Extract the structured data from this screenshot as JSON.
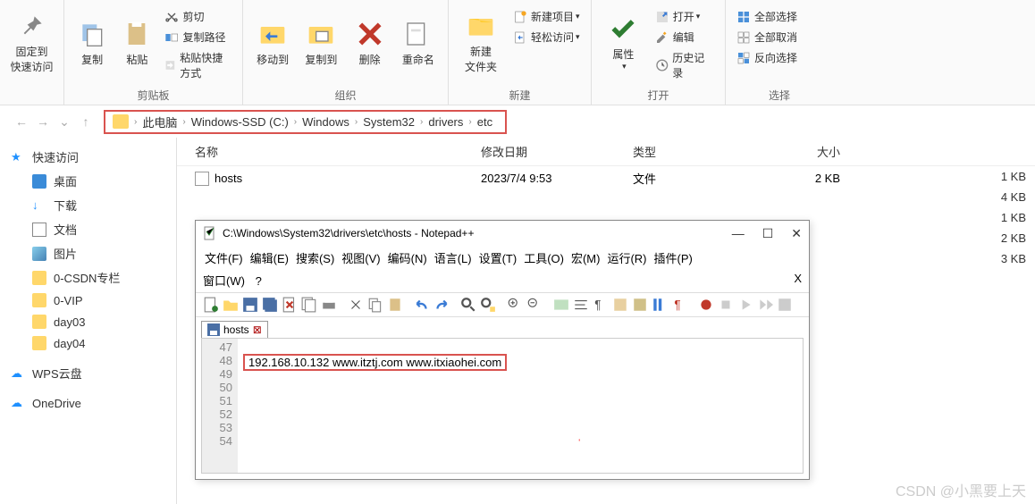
{
  "ribbon": {
    "pin": "固定到\n快速访问",
    "copy": "复制",
    "paste": "粘贴",
    "cut": "剪切",
    "copy_path": "复制路径",
    "paste_shortcut": "粘贴快捷方式",
    "clipboard_label": "剪贴板",
    "move_to": "移动到",
    "copy_to": "复制到",
    "delete": "删除",
    "rename": "重命名",
    "organize_label": "组织",
    "new_folder": "新建\n文件夹",
    "new_item": "新建项目",
    "easy_access": "轻松访问",
    "new_label": "新建",
    "properties": "属性",
    "open": "打开",
    "edit": "编辑",
    "history": "历史记录",
    "open_label": "打开",
    "select_all": "全部选择",
    "select_none": "全部取消",
    "invert_selection": "反向选择",
    "select_label": "选择"
  },
  "breadcrumb": [
    "此电脑",
    "Windows-SSD (C:)",
    "Windows",
    "System32",
    "drivers",
    "etc"
  ],
  "sidebar": {
    "quick_access": "快速访问",
    "desktop": "桌面",
    "downloads": "下载",
    "documents": "文档",
    "pictures": "图片",
    "csdn": "0-CSDN专栏",
    "vip": "0-VIP",
    "day03": "day03",
    "day04": "day04",
    "wps": "WPS云盘",
    "onedrive": "OneDrive"
  },
  "headers": {
    "name": "名称",
    "date": "修改日期",
    "type": "类型",
    "size": "大小"
  },
  "file": {
    "name": "hosts",
    "date": "2023/7/4 9:53",
    "type": "文件",
    "size": "2 KB"
  },
  "extra_sizes": [
    "1 KB",
    "4 KB",
    "1 KB",
    "2 KB",
    "3 KB"
  ],
  "npp": {
    "title": "C:\\Windows\\System32\\drivers\\etc\\hosts - Notepad++",
    "menu": [
      "文件(F)",
      "编辑(E)",
      "搜索(S)",
      "视图(V)",
      "编码(N)",
      "语言(L)",
      "设置(T)",
      "工具(O)",
      "宏(M)",
      "运行(R)",
      "插件(P)"
    ],
    "menu2": [
      "窗口(W)",
      "?"
    ],
    "tab": "hosts",
    "lines": [
      "47",
      "48",
      "49",
      "50",
      "51",
      "52",
      "53",
      "54"
    ],
    "content_line": "192.168.10.132  www.itztj.com   www.itxiaohei.com"
  },
  "watermark": "CSDN @小黑要上天"
}
